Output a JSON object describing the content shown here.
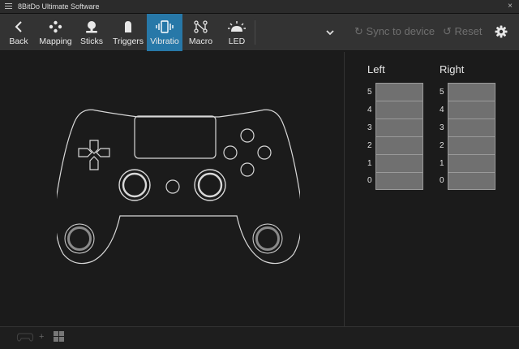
{
  "app": {
    "title": "8BitDo Ultimate Software",
    "close": "×"
  },
  "toolbar": {
    "tabs": [
      {
        "label": "Back",
        "icon": "chevron-left-icon"
      },
      {
        "label": "Mapping",
        "icon": "dpad-dots-icon"
      },
      {
        "label": "Sticks",
        "icon": "joystick-icon"
      },
      {
        "label": "Triggers",
        "icon": "trigger-icon"
      },
      {
        "label": "Vibratio",
        "icon": "vibration-icon",
        "active": true
      },
      {
        "label": "Macro",
        "icon": "macro-icon"
      },
      {
        "label": "LED",
        "icon": "led-icon"
      }
    ],
    "sync_label": "Sync to device",
    "reset_label": "Reset",
    "accent_color": "#2778a8"
  },
  "vibration": {
    "left_label": "Left",
    "right_label": "Right",
    "levels": [
      "5",
      "4",
      "3",
      "2",
      "1",
      "0"
    ]
  },
  "bottom": {
    "plus": "+"
  }
}
